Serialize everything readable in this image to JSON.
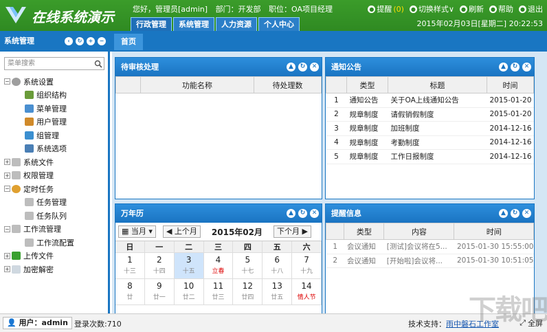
{
  "app": {
    "title": "在线系统演示",
    "greeting": "您好，管理员[admin]",
    "dept": "部门：开发部",
    "position": "职位：OA项目经理",
    "datetime": "2015年02月03日[星期二] 20:22:53"
  },
  "top_actions": [
    {
      "label": "提醒",
      "count": "(0)",
      "icon": "bell-icon"
    },
    {
      "label": "切换样式∨",
      "icon": "palette-icon"
    },
    {
      "label": "刷新",
      "icon": "refresh-icon"
    },
    {
      "label": "帮助",
      "icon": "help-icon"
    },
    {
      "label": "退出",
      "icon": "exit-icon"
    }
  ],
  "nav_tabs": [
    "行政管理",
    "系统管理",
    "人力资源",
    "个人中心"
  ],
  "sidebar": {
    "title": "系统管理",
    "search_placeholder": "菜单搜索",
    "tree": [
      {
        "label": "系统设置",
        "level": 1,
        "icon": "gear-icon",
        "expanded": true
      },
      {
        "label": "组织结构",
        "level": 2,
        "icon": "org-icon"
      },
      {
        "label": "菜单管理",
        "level": 2,
        "icon": "menu-icon"
      },
      {
        "label": "用户管理",
        "level": 2,
        "icon": "user-icon"
      },
      {
        "label": "组管理",
        "level": 2,
        "icon": "group-icon"
      },
      {
        "label": "系统选项",
        "level": 2,
        "icon": "wrench-icon"
      },
      {
        "label": "系统文件",
        "level": 1,
        "icon": "folder-icon"
      },
      {
        "label": "权限管理",
        "level": 1,
        "icon": "folder-icon"
      },
      {
        "label": "定时任务",
        "level": 1,
        "icon": "clock-icon",
        "expanded": true
      },
      {
        "label": "任务管理",
        "level": 2,
        "icon": "folder-icon"
      },
      {
        "label": "任务队列",
        "level": 2,
        "icon": "folder-icon"
      },
      {
        "label": "工作流管理",
        "level": 1,
        "icon": "folder-icon",
        "expanded": true
      },
      {
        "label": "工作流配置",
        "level": 2,
        "icon": "folder-icon"
      },
      {
        "label": "上传文件",
        "level": 1,
        "icon": "upload-icon"
      },
      {
        "label": "加密解密",
        "level": 1,
        "icon": "doc-icon"
      }
    ]
  },
  "main_tab": "首页",
  "pending": {
    "title": "待审核处理",
    "headers": [
      "功能名称",
      "待处理数"
    ],
    "rows": []
  },
  "notice": {
    "title": "通知公告",
    "headers": [
      "类型",
      "标题",
      "时间"
    ],
    "rows": [
      [
        "1",
        "通知公告",
        "关于OA上线通知公告",
        "2015-01-20"
      ],
      [
        "2",
        "规章制度",
        "请假销假制度",
        "2015-01-20"
      ],
      [
        "3",
        "规章制度",
        "加班制度",
        "2014-12-16"
      ],
      [
        "4",
        "规章制度",
        "考勤制度",
        "2014-12-16"
      ],
      [
        "5",
        "规章制度",
        "工作日报制度",
        "2014-12-16"
      ]
    ]
  },
  "calendar": {
    "title": "万年历",
    "today_btn": "当月",
    "prev": "上个月",
    "next": "下个月",
    "month": "2015年02月",
    "weekdays": [
      "日",
      "一",
      "二",
      "三",
      "四",
      "五",
      "六"
    ],
    "days": [
      {
        "d": "1",
        "l": "十三"
      },
      {
        "d": "2",
        "l": "十四"
      },
      {
        "d": "3",
        "l": "十五",
        "today": true
      },
      {
        "d": "4",
        "l": "立春",
        "red": true
      },
      {
        "d": "5",
        "l": "十七"
      },
      {
        "d": "6",
        "l": "十八"
      },
      {
        "d": "7",
        "l": "十九"
      },
      {
        "d": "8",
        "l": "廿"
      },
      {
        "d": "9",
        "l": "廿一"
      },
      {
        "d": "10",
        "l": "廿二"
      },
      {
        "d": "11",
        "l": "廿三"
      },
      {
        "d": "12",
        "l": "廿四"
      },
      {
        "d": "13",
        "l": "廿五"
      },
      {
        "d": "14",
        "l": "情人节",
        "red": true
      }
    ]
  },
  "reminder": {
    "title": "提醒信息",
    "headers": [
      "类型",
      "内容",
      "时间"
    ],
    "rows": [
      [
        "1",
        "会议通知",
        "[测试]会议将在5...",
        "2015-01-30 15:55:00"
      ],
      [
        "2",
        "会议通知",
        "[开始啦]会议将...",
        "2015-01-30 10:51:05"
      ]
    ]
  },
  "status": {
    "user": "用户：admin",
    "login_count": "登录次数:710",
    "support_label": "技术支持：",
    "support_link": "雨中磐石工作室",
    "fullscreen": "全屏"
  },
  "watermark": "下载吧"
}
